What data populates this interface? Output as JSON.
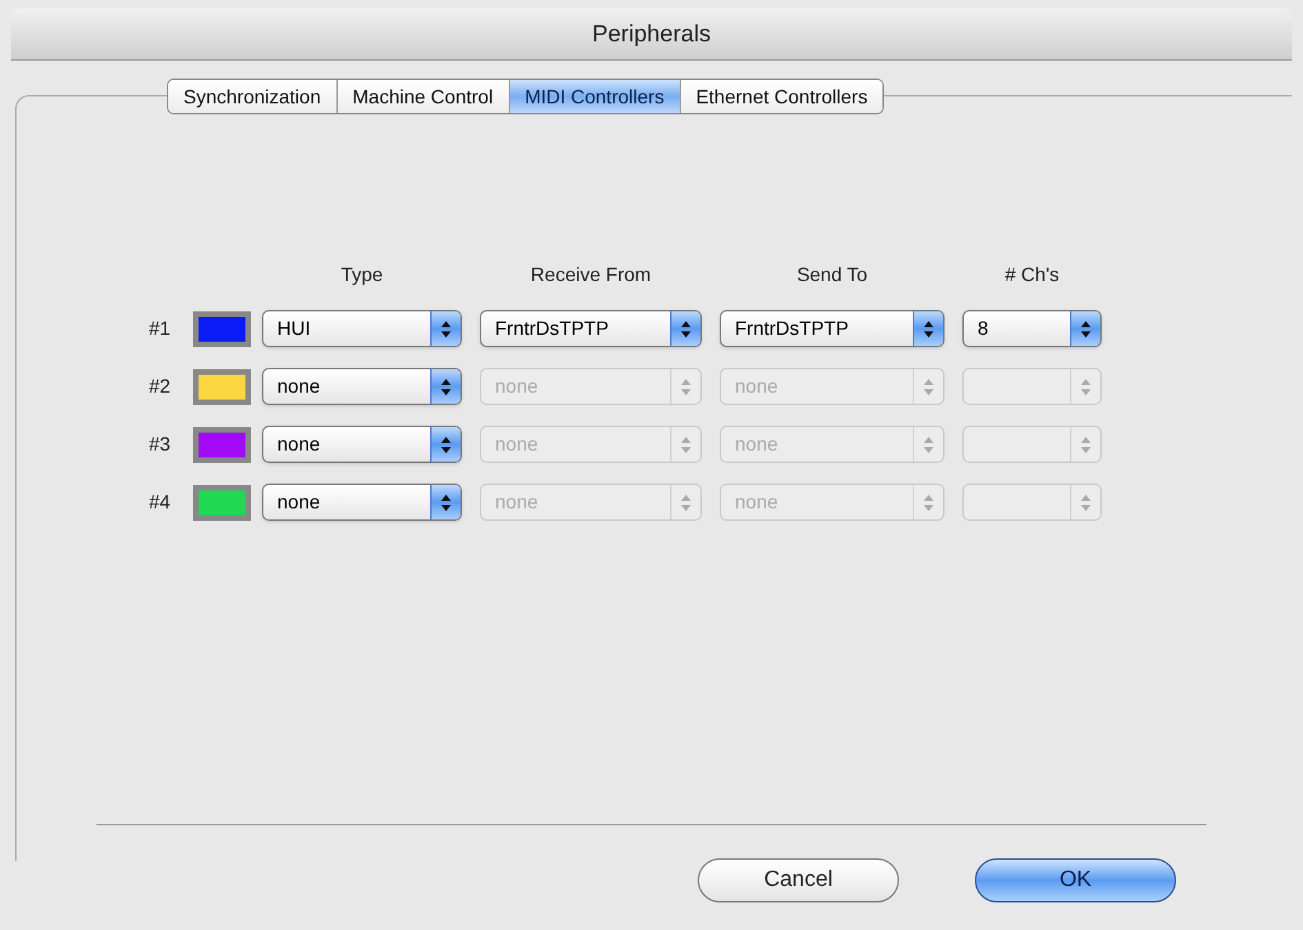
{
  "window": {
    "title": "Peripherals"
  },
  "tabs": [
    {
      "label": "Synchronization",
      "selected": false
    },
    {
      "label": "Machine Control",
      "selected": false
    },
    {
      "label": "MIDI Controllers",
      "selected": true
    },
    {
      "label": "Ethernet Controllers",
      "selected": false
    }
  ],
  "columns": [
    "Type",
    "Receive From",
    "Send To",
    "# Ch's"
  ],
  "controllers": [
    {
      "label": "#1",
      "color": "#0a1cf5",
      "popups": [
        {
          "value": "HUI",
          "disabled": false
        },
        {
          "value": "FrntrDsTPTP",
          "disabled": false
        },
        {
          "value": "FrntrDsTPTP",
          "disabled": false
        },
        {
          "value": "8",
          "disabled": false
        }
      ]
    },
    {
      "label": "#2",
      "color": "#fcd640",
      "popups": [
        {
          "value": "none",
          "disabled": false
        },
        {
          "value": "none",
          "disabled": true
        },
        {
          "value": "none",
          "disabled": true
        },
        {
          "disabled": true
        }
      ]
    },
    {
      "label": "#3",
      "color": "#a20af5",
      "popups": [
        {
          "value": "none",
          "disabled": false
        },
        {
          "value": "none",
          "disabled": true
        },
        {
          "value": "none",
          "disabled": true
        },
        {
          "disabled": true
        }
      ]
    },
    {
      "label": "#4",
      "color": "#22d752",
      "popups": [
        {
          "value": "none",
          "disabled": false
        },
        {
          "value": "none",
          "disabled": true
        },
        {
          "value": "none",
          "disabled": true
        },
        {
          "disabled": true
        }
      ]
    }
  ],
  "buttons": [
    {
      "label": "Cancel",
      "default": false
    },
    {
      "label": "OK",
      "default": true
    }
  ]
}
